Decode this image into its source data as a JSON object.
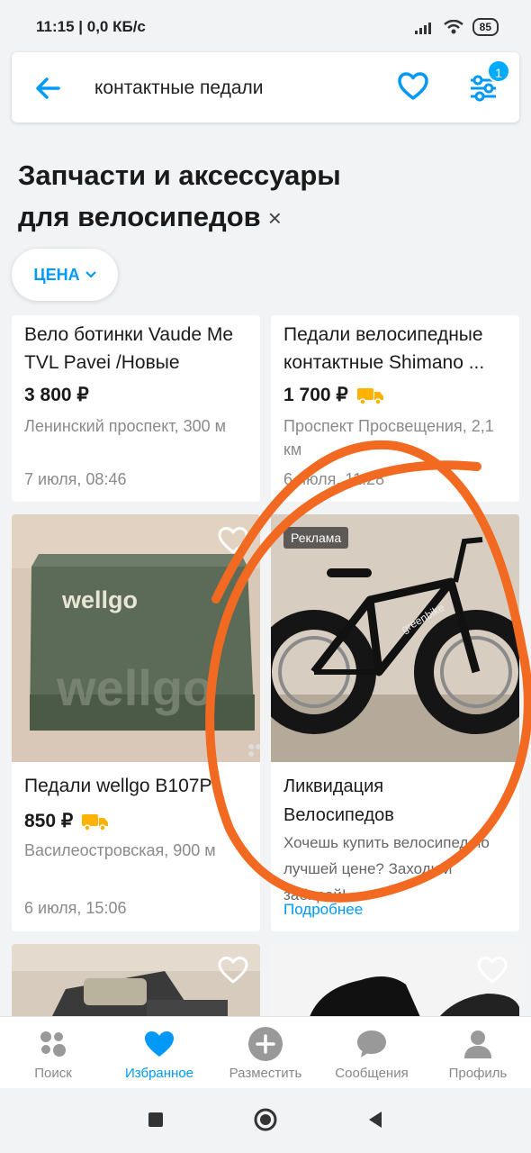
{
  "status": {
    "time": "11:15 | 0,0 КБ/с",
    "battery": "85"
  },
  "search": {
    "query": "контактные педали",
    "filter_badge": "1"
  },
  "category": {
    "title": "Запчасти и аксессуары для велосипедов",
    "close": "×"
  },
  "filters": {
    "price_label": "ЦЕНА"
  },
  "listings": [
    {
      "title": "Вело ботинки Vaude Me TVL Pavei /Новые",
      "price": "3 800 ₽",
      "location": "Ленинский проспект, 300 м",
      "date": "7 июля, 08:46"
    },
    {
      "title": "Педали велосипедные контактные Shimano ...",
      "price": "1 700 ₽",
      "location": "Проспект Просвещения, 2,1 км",
      "date": "6 июля, 11:28"
    },
    {
      "title": "Педали wellgo B107P",
      "price": "850 ₽",
      "location": "Василеостровская, 900 м",
      "date": "6 июля, 15:06",
      "image_text": "wellgo"
    },
    {
      "ad_badge": "Реклама",
      "title": "Ликвидация Велосипедов",
      "description": "Хочешь купить велосипед по лучшей цене? Заходи и забирай!",
      "more": "Подробнее",
      "image_text": "greenbike"
    }
  ],
  "tabs": [
    {
      "label": "Поиск",
      "icon": "search-dots-icon"
    },
    {
      "label": "Избранное",
      "icon": "heart-icon",
      "active": true
    },
    {
      "label": "Разместить",
      "icon": "plus-icon"
    },
    {
      "label": "Сообщения",
      "icon": "chat-icon"
    },
    {
      "label": "Профиль",
      "icon": "profile-icon"
    }
  ],
  "colors": {
    "accent": "#0099f7",
    "annotation": "#f26a21",
    "delivery": "#ffb300"
  }
}
